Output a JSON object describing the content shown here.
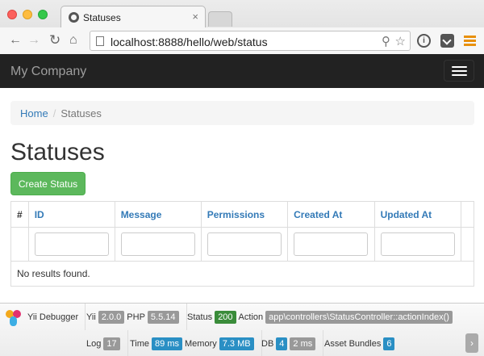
{
  "browser": {
    "tab_title": "Statuses",
    "tab_close": "×",
    "url": "localhost:8888/hello/web/status"
  },
  "navbar": {
    "brand": "My Company"
  },
  "breadcrumb": {
    "home": "Home",
    "separator": "/",
    "current": "Statuses"
  },
  "page": {
    "title": "Statuses",
    "create_button": "Create Status"
  },
  "grid": {
    "columns": [
      "#",
      "ID",
      "Message",
      "Permissions",
      "Created At",
      "Updated At",
      ""
    ],
    "empty_text": "No results found."
  },
  "debugger": {
    "title": "Yii Debugger",
    "yii_label": "Yii",
    "yii_version": "2.0.0",
    "php_label": "PHP",
    "php_version": "5.5.14",
    "status_label": "Status",
    "status_value": "200",
    "action_label": "Action",
    "action_value": "app\\controllers\\StatusController::actionIndex()",
    "log_label": "Log",
    "log_value": "17",
    "time_label": "Time",
    "time_value": "89 ms",
    "memory_label": "Memory",
    "memory_value": "7.3 MB",
    "db_label": "DB",
    "db_queries": "4",
    "db_time": "2 ms",
    "assets_label": "Asset Bundles",
    "assets_value": "6"
  },
  "colors": {
    "navbar_bg": "#222222",
    "brand_text": "#9d9d9d",
    "link": "#337ab7",
    "success_button": "#5cb85c",
    "status_label": "#3a8c3a",
    "info_label": "#2a8fc4"
  }
}
